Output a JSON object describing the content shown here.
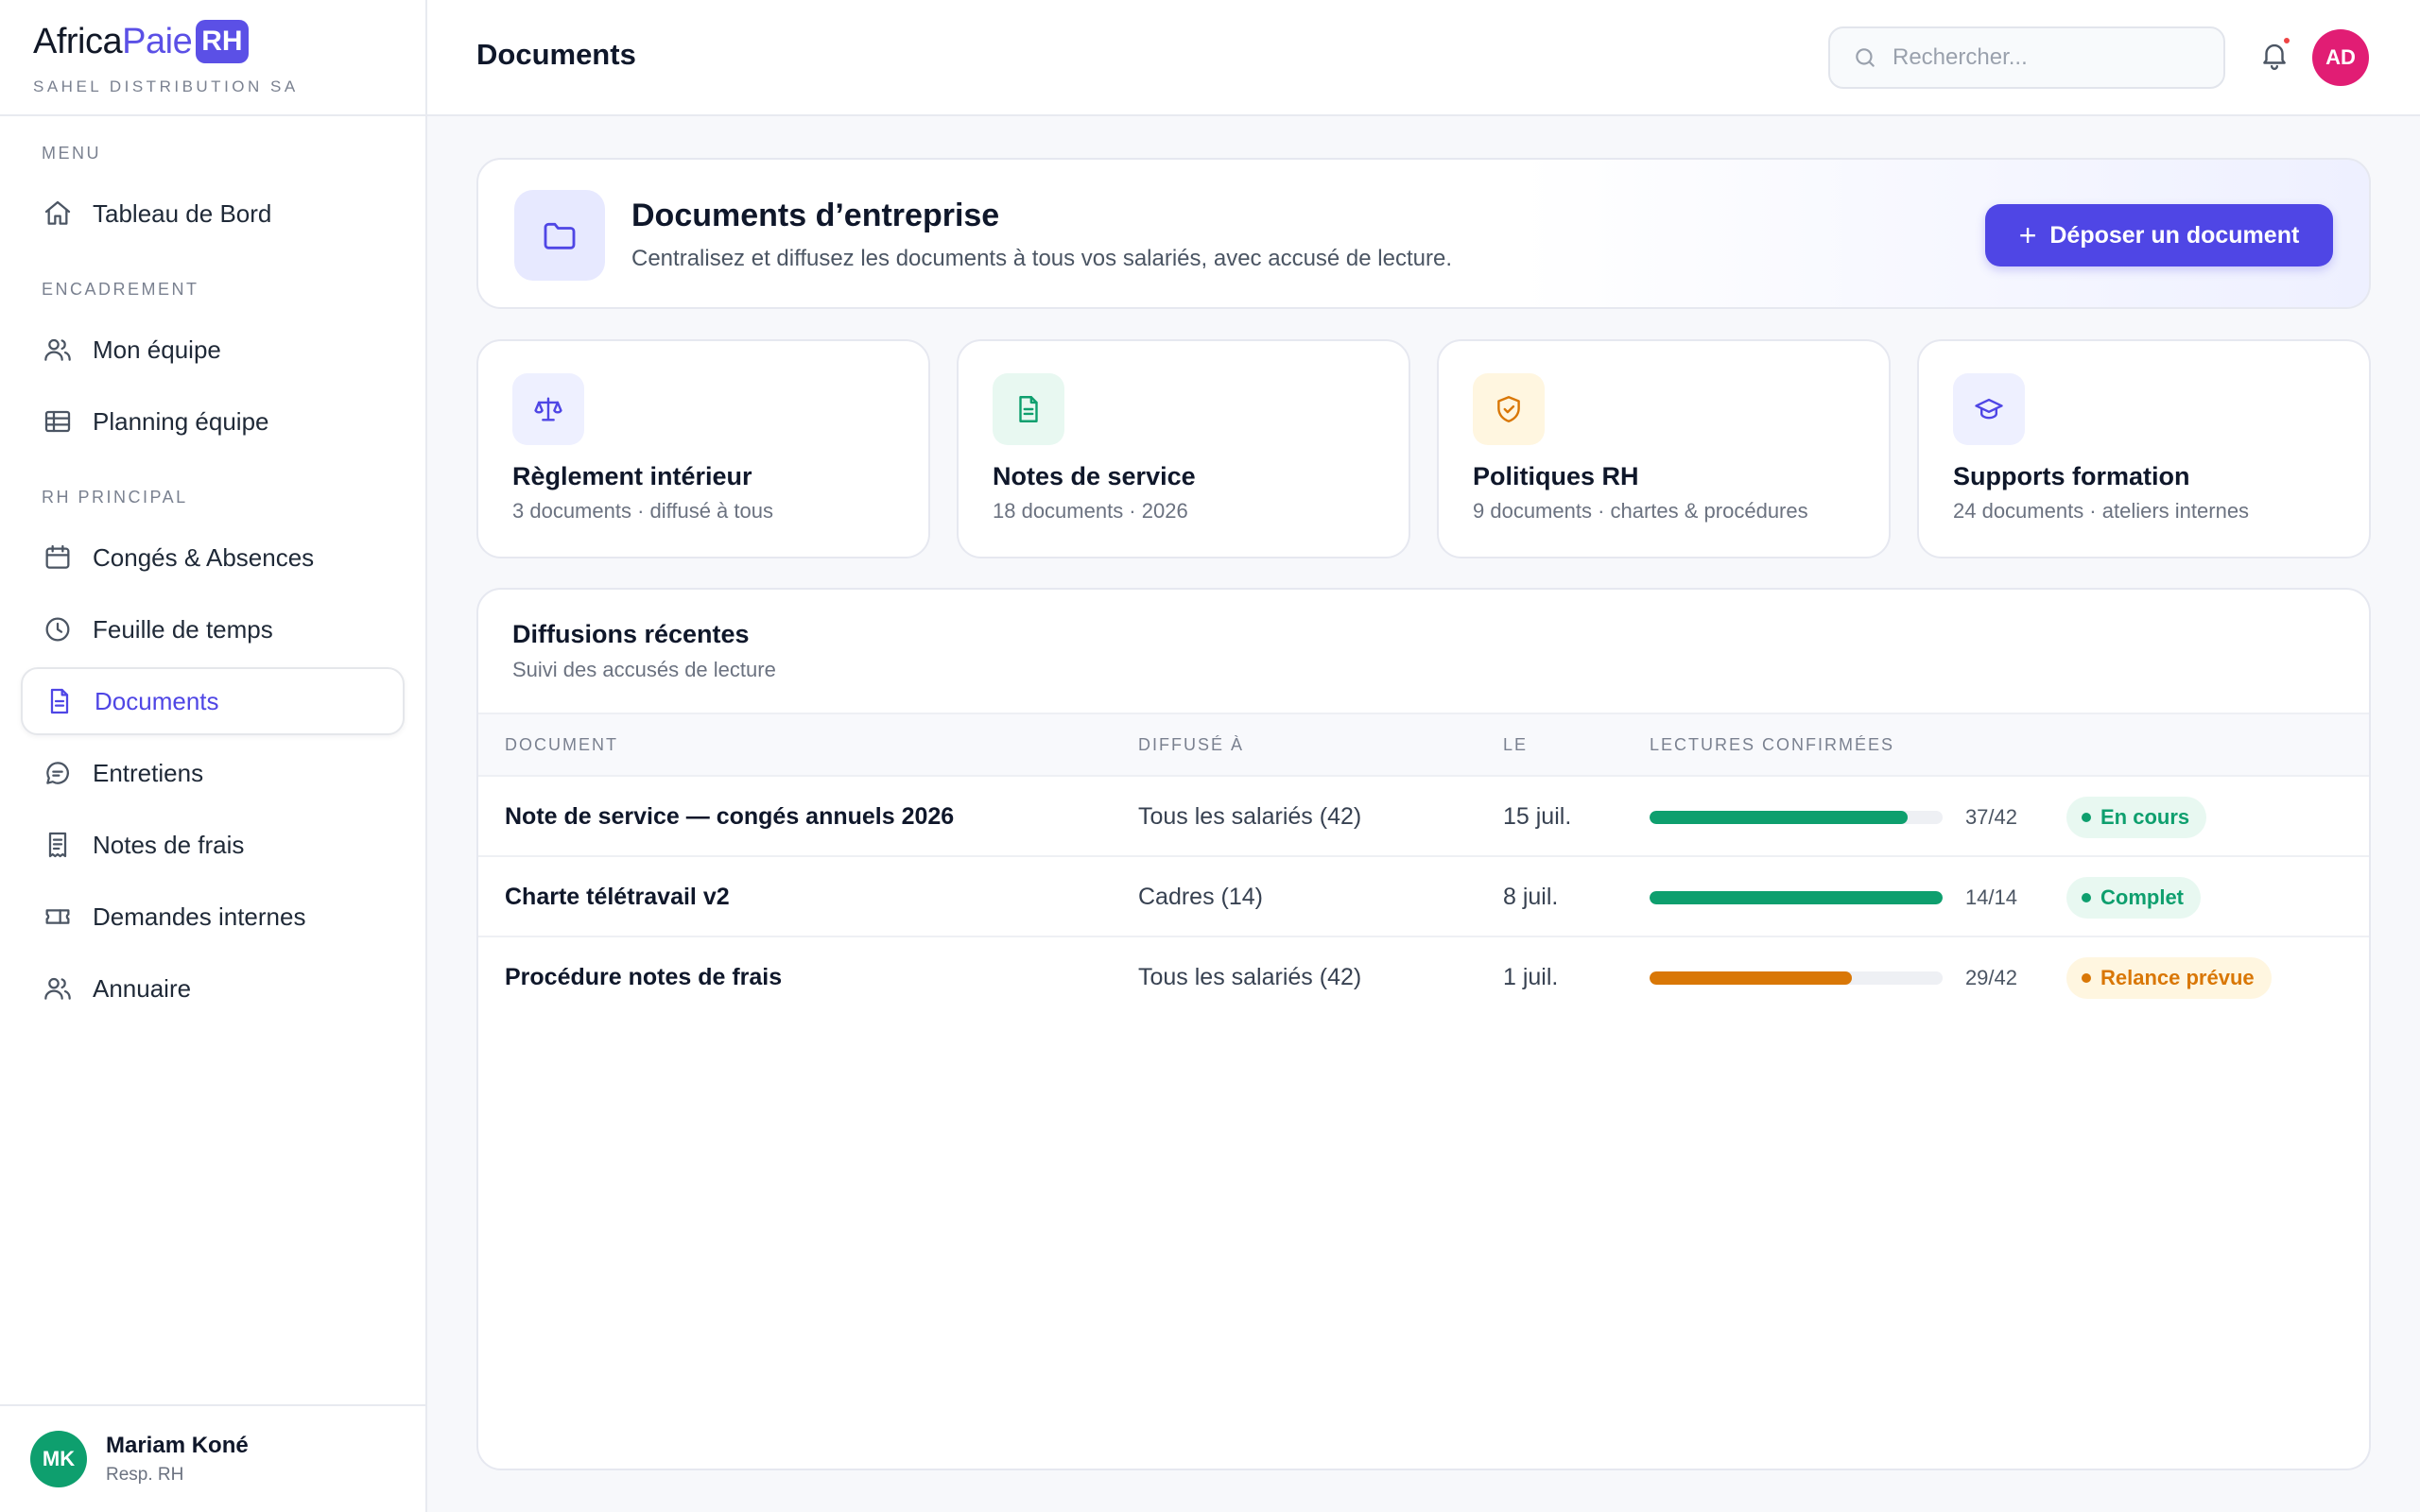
{
  "brand": {
    "africa": "Africa",
    "paie": "Paie",
    "rh": "RH",
    "company": "SAHEL DISTRIBUTION SA"
  },
  "sidebar": {
    "sections": [
      "MENU",
      "ENCADREMENT",
      "RH PRINCIPAL"
    ],
    "items": [
      {
        "label": "Tableau de Bord",
        "icon": "home-icon"
      },
      {
        "label": "Mon équipe",
        "icon": "users-icon"
      },
      {
        "label": "Planning équipe",
        "icon": "table-icon"
      },
      {
        "label": "Congés & Absences",
        "icon": "calendar-icon"
      },
      {
        "label": "Feuille de temps",
        "icon": "clock-icon"
      },
      {
        "label": "Documents",
        "icon": "document-icon",
        "active": true
      },
      {
        "label": "Entretiens",
        "icon": "chat-icon"
      },
      {
        "label": "Notes de frais",
        "icon": "receipt-icon"
      },
      {
        "label": "Demandes internes",
        "icon": "ticket-icon"
      },
      {
        "label": "Annuaire",
        "icon": "contacts-icon"
      }
    ],
    "user": {
      "initials": "MK",
      "name": "Mariam Koné",
      "role": "Resp. RH"
    }
  },
  "header": {
    "title": "Documents",
    "search_placeholder": "Rechercher...",
    "avatar_initials": "AD"
  },
  "hero": {
    "title": "Documents d’entreprise",
    "subtitle": "Centralisez et diffusez les documents à tous vos salariés, avec accusé de lecture.",
    "button_plus": "+",
    "button_label": "Déposer un document"
  },
  "categories": [
    {
      "title": "Règlement intérieur",
      "subtitle": "3 documents · diffusé à tous",
      "icon": "scale-icon",
      "color": "#4f46e5",
      "bg": "#eef0ff"
    },
    {
      "title": "Notes de service",
      "subtitle": "18 documents · 2026",
      "icon": "file-text-icon",
      "color": "#0e9f6e",
      "bg": "#e8f8f1"
    },
    {
      "title": "Politiques RH",
      "subtitle": "9 documents · chartes & procédures",
      "icon": "shield-check-icon",
      "color": "#d97706",
      "bg": "#fff6e0"
    },
    {
      "title": "Supports formation",
      "subtitle": "24 documents · ateliers internes",
      "icon": "graduation-cap-icon",
      "color": "#4f46e5",
      "bg": "#eef0ff"
    }
  ],
  "table": {
    "title": "Diffusions récentes",
    "subtitle": "Suivi des accusés de lecture",
    "columns": [
      "DOCUMENT",
      "DIFFUSÉ À",
      "LE",
      "LECTURES CONFIRMÉES"
    ],
    "rows": [
      {
        "document": "Note de service — congés annuels 2026",
        "diffuse_a": "Tous les salariés (42)",
        "le": "15 juil.",
        "read": 37,
        "total": 42,
        "count": "37/42",
        "status": "En cours",
        "status_color": "#0e9f6e",
        "status_bg": "#e8f8f1",
        "bar_color": "#0e9f6e"
      },
      {
        "document": "Charte télétravail v2",
        "diffuse_a": "Cadres (14)",
        "le": "8 juil.",
        "read": 14,
        "total": 14,
        "count": "14/14",
        "status": "Complet",
        "status_color": "#0e9f6e",
        "status_bg": "#e8f8f1",
        "bar_color": "#0e9f6e"
      },
      {
        "document": "Procédure notes de frais",
        "diffuse_a": "Tous les salariés (42)",
        "le": "1 juil.",
        "read": 29,
        "total": 42,
        "count": "29/42",
        "status": "Relance prévue",
        "status_color": "#d97706",
        "status_bg": "#fff6e0",
        "bar_color": "#d97706"
      }
    ]
  }
}
